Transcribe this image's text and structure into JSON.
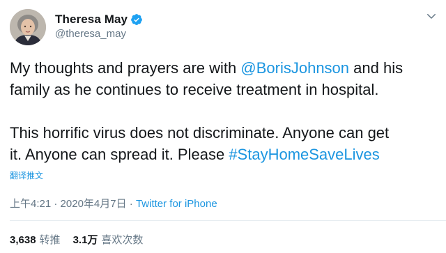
{
  "author": {
    "display_name": "Theresa May",
    "handle": "@theresa_may",
    "verified": true
  },
  "tweet": {
    "line1_pre": "My thoughts and prayers are with ",
    "mention": "@BorisJohnson",
    "line1_post": " and his",
    "line2": "family as he continues to receive treatment in hospital.",
    "line3": "This horrific virus does not discriminate. Anyone can get",
    "line4_pre": "it. Anyone can spread it. Please ",
    "hashtag": "#StayHomeSaveLives"
  },
  "translate_label": "翻译推文",
  "meta": {
    "time": "上午4:21",
    "separator": " · ",
    "date": "2020年4月7日",
    "separator2": " · ",
    "source": "Twitter for iPhone"
  },
  "stats": {
    "retweets_count": "3,638",
    "retweets_label": "转推",
    "likes_count": "3.1万",
    "likes_label": "喜欢次数"
  },
  "colors": {
    "link": "#1b95e0",
    "muted": "#657786",
    "text": "#14171a",
    "divider": "#e6ecf0",
    "verified": "#1da1f2"
  },
  "icons": {
    "verified": "verified-badge-icon",
    "more": "chevron-down-icon"
  }
}
